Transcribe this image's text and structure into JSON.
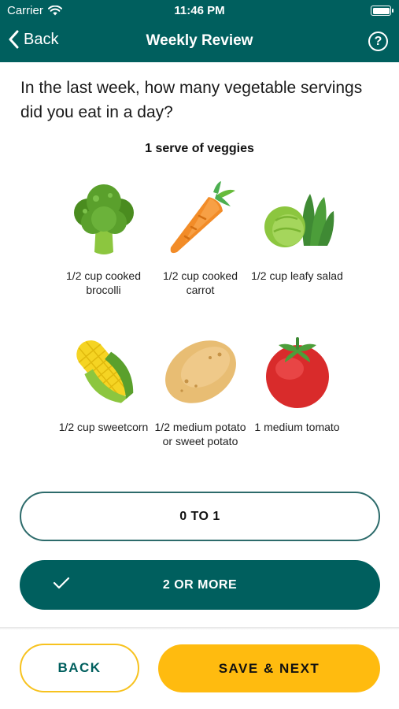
{
  "status_bar": {
    "carrier": "Carrier",
    "time": "11:46 PM"
  },
  "nav": {
    "back_label": "Back",
    "title": "Weekly Review",
    "help_glyph": "?"
  },
  "question": "In the last week, how many vegetable servings did you eat in a day?",
  "serve_heading": "1 serve of veggies",
  "vegetables": [
    {
      "label": "1/2 cup cooked brocolli",
      "icon": "broccoli-icon"
    },
    {
      "label": "1/2 cup cooked carrot",
      "icon": "carrot-icon"
    },
    {
      "label": "1/2 cup leafy salad",
      "icon": "leafy-salad-icon"
    },
    {
      "label": "1/2 cup sweetcorn",
      "icon": "sweetcorn-icon"
    },
    {
      "label": "1/2 medium potato or sweet potato",
      "icon": "potato-icon"
    },
    {
      "label": "1 medium tomato",
      "icon": "tomato-icon"
    }
  ],
  "options": [
    {
      "label": "0 TO 1",
      "selected": false
    },
    {
      "label": "2 OR MORE",
      "selected": true
    }
  ],
  "footer": {
    "back_label": "BACK",
    "next_label": "SAVE & NEXT"
  },
  "colors": {
    "primary": "#005f5e",
    "accent": "#ffbb0f"
  }
}
